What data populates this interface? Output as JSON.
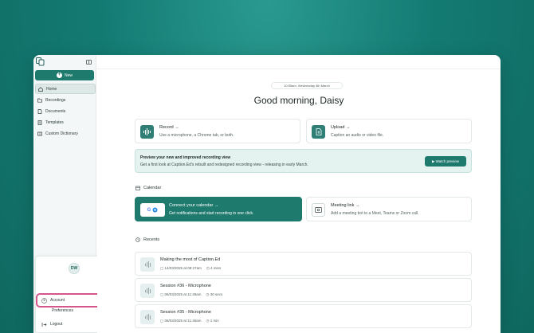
{
  "sidebar": {
    "new_label": "New",
    "items": [
      {
        "label": "Home",
        "icon": "home-icon"
      },
      {
        "label": "Recordings",
        "icon": "folder-icon"
      },
      {
        "label": "Documents",
        "icon": "document-icon"
      },
      {
        "label": "Templates",
        "icon": "template-icon"
      },
      {
        "label": "Custom Dictionary",
        "icon": "dictionary-icon"
      }
    ]
  },
  "account_menu": {
    "avatar_initials": "DW",
    "account_label": "Account",
    "preferences_label": "Preferences",
    "logout_label": "Logout"
  },
  "main": {
    "datetime": "10:55am, Wednesday 4th March",
    "greeting": "Good morning, Daisy",
    "record": {
      "title": "Record",
      "arrow": "→",
      "subtitle": "Use a microphone, a Chrome tab, or both."
    },
    "upload": {
      "title": "Upload",
      "arrow": "→",
      "subtitle": "Caption an audio or video file."
    },
    "banner": {
      "title": "Preview your new and improved recording view",
      "subtitle": "Get a first look at Caption.Ed's rebuilt and redesigned recording view - releasing in early March.",
      "button": "▶ Watch preview"
    },
    "calendar_label": "Calendar",
    "connect": {
      "title": "Connect your calendar",
      "arrow": "→",
      "subtitle": "Get notifications and start recording in one click.",
      "google_letter": "G"
    },
    "meeting": {
      "title": "Meeting link",
      "arrow": "→",
      "subtitle": "Add a meeting bot to a Meet, Teams or Zoom call."
    },
    "recents_label": "Recents",
    "recents": [
      {
        "title": "Making the most of Caption.Ed",
        "date": "14/03/2025 at 08:27am",
        "duration": "4 mins"
      },
      {
        "title": "Session #36 - Microphone",
        "date": "06/03/2025 at 11:49am",
        "duration": "30 secs"
      },
      {
        "title": "Session #35 - Microphone",
        "date": "06/03/2025 at 11:46am",
        "duration": "1 min"
      }
    ]
  },
  "colors": {
    "brand": "#1f7a6e",
    "highlight": "#d4568a",
    "background": "#137a72"
  }
}
